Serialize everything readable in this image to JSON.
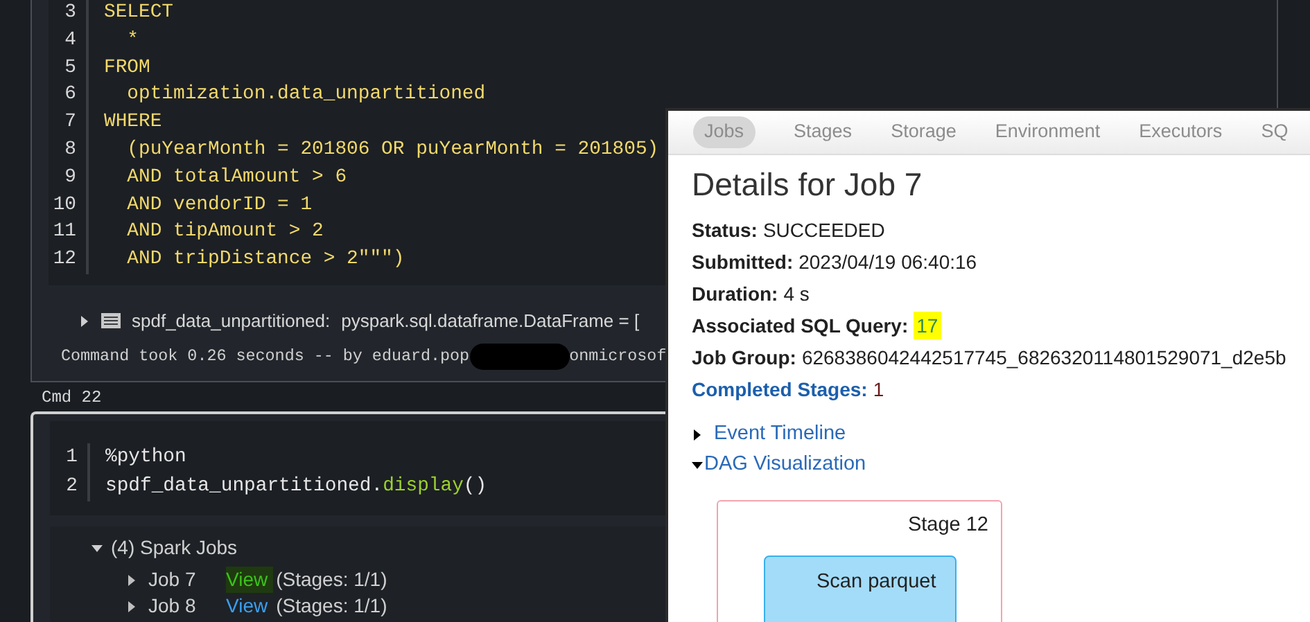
{
  "notebook": {
    "cell_1": {
      "code_lines": [
        {
          "number": "3",
          "segments": [
            {
              "kind": "keyword",
              "text": "SELECT"
            }
          ]
        },
        {
          "number": "4",
          "segments": [
            {
              "kind": "keyword",
              "text": "  *"
            }
          ]
        },
        {
          "number": "5",
          "segments": [
            {
              "kind": "keyword",
              "text": "FROM"
            }
          ]
        },
        {
          "number": "6",
          "segments": [
            {
              "kind": "keyword",
              "text": "  optimization.data_unpartitioned"
            }
          ]
        },
        {
          "number": "7",
          "segments": [
            {
              "kind": "keyword",
              "text": "WHERE"
            }
          ]
        },
        {
          "number": "8",
          "segments": [
            {
              "kind": "keyword",
              "text": "  (puYearMonth = 201806 OR puYearMonth = 201805)"
            }
          ]
        },
        {
          "number": "9",
          "segments": [
            {
              "kind": "keyword",
              "text": "  AND totalAmount > 6"
            }
          ]
        },
        {
          "number": "10",
          "segments": [
            {
              "kind": "keyword",
              "text": "  AND vendorID = 1"
            }
          ]
        },
        {
          "number": "11",
          "segments": [
            {
              "kind": "keyword",
              "text": "  AND tipAmount > 2"
            }
          ]
        },
        {
          "number": "12",
          "segments": [
            {
              "kind": "keyword",
              "text": "  AND tripDistance > 2\"\"\")"
            }
          ]
        }
      ],
      "result": {
        "expanded": false,
        "name": "spdf_data_unpartitioned:",
        "type": "pyspark.sql.dataframe.DataFrame = ["
      },
      "command_info": {
        "before": "Command took 0.26 seconds -- by eduard.pop",
        "after": "onmicrosof"
      }
    },
    "cmd_label": "Cmd 22",
    "cell_2": {
      "code_lines": [
        {
          "number": "1",
          "segments": [
            {
              "kind": "plain",
              "text": "%python"
            }
          ]
        },
        {
          "number": "2",
          "segments": [
            {
              "kind": "plain",
              "text": "spdf_data_unpartitioned."
            },
            {
              "kind": "function",
              "text": "display"
            },
            {
              "kind": "plain",
              "text": "()"
            }
          ]
        }
      ],
      "spark_jobs": {
        "label": "(4) Spark Jobs",
        "expanded": true,
        "jobs": [
          {
            "name": "Job 7",
            "link": "View",
            "stages": "(Stages: 1/1)",
            "expanded": false,
            "highlighted": true
          },
          {
            "name": "Job 8",
            "link": "View",
            "stages": "(Stages: 1/1)",
            "expanded": false,
            "highlighted": false
          }
        ]
      }
    }
  },
  "spark_ui": {
    "tabs": [
      {
        "label": "Jobs",
        "selected": true
      },
      {
        "label": "Stages",
        "selected": false
      },
      {
        "label": "Storage",
        "selected": false
      },
      {
        "label": "Environment",
        "selected": false
      },
      {
        "label": "Executors",
        "selected": false
      },
      {
        "label": "SQ",
        "selected": false
      }
    ],
    "title": "Details for Job 7",
    "details": [
      {
        "label": "Status:",
        "value": "SUCCEEDED",
        "highlighted": false
      },
      {
        "label": "Submitted:",
        "value": "2023/04/19 06:40:16",
        "highlighted": false
      },
      {
        "label": "Duration:",
        "value": "4 s",
        "highlighted": false
      },
      {
        "label": "Associated SQL Query:",
        "value": "17",
        "highlighted": true
      },
      {
        "label": "Job Group:",
        "value": "6268386042442517745_6826320114801529071_d2e5b",
        "highlighted": false
      }
    ],
    "completed_stages": {
      "label": "Completed Stages:",
      "value": "1"
    },
    "sections": [
      {
        "label": "Event Timeline",
        "expanded": false
      },
      {
        "label": "DAG Visualization",
        "expanded": true
      }
    ],
    "dag": {
      "stage": "Stage 12",
      "node": "Scan parquet"
    }
  }
}
